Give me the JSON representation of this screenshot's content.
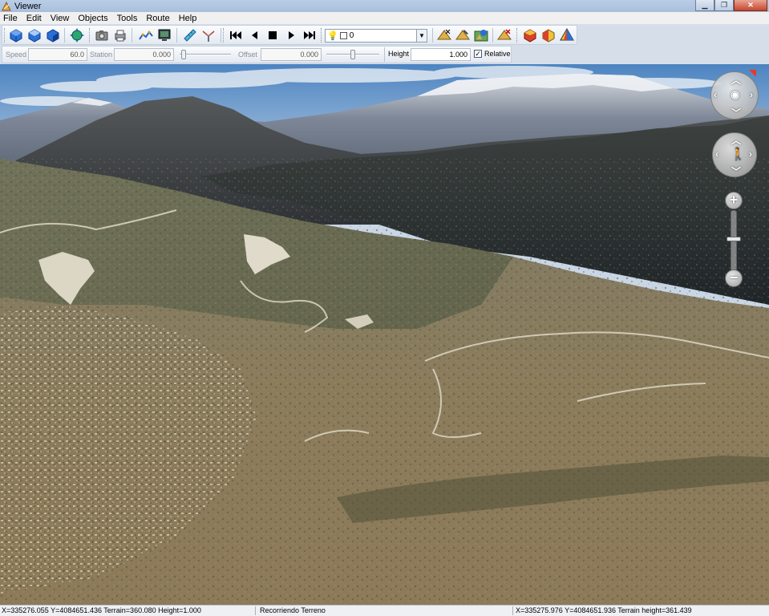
{
  "window": {
    "title": "Viewer"
  },
  "menu": [
    "File",
    "Edit",
    "View",
    "Objects",
    "Tools",
    "Route",
    "Help"
  ],
  "toolbar": {
    "layer_value": "0"
  },
  "route_bar": {
    "speed_label": "Speed",
    "speed_value": "60.0",
    "station_label": "Station",
    "station_value": "0.000",
    "offset_label": "Offset",
    "offset_value": "0.000",
    "height_label": "Height",
    "height_value": "1.000",
    "relative_label": "Relative",
    "relative_checked": true
  },
  "status": {
    "left": "X=335276.055 Y=4084651.436 Terrain=360.080 Height=1.000",
    "middle": "Recorriendo Terreno",
    "right": "X=335275.976 Y=4084651.936 Terrain height=361.439"
  },
  "colors": {
    "accent_north": "#e23b2a",
    "sky_top": "#4f86c2",
    "terrain": "#7d7458"
  }
}
